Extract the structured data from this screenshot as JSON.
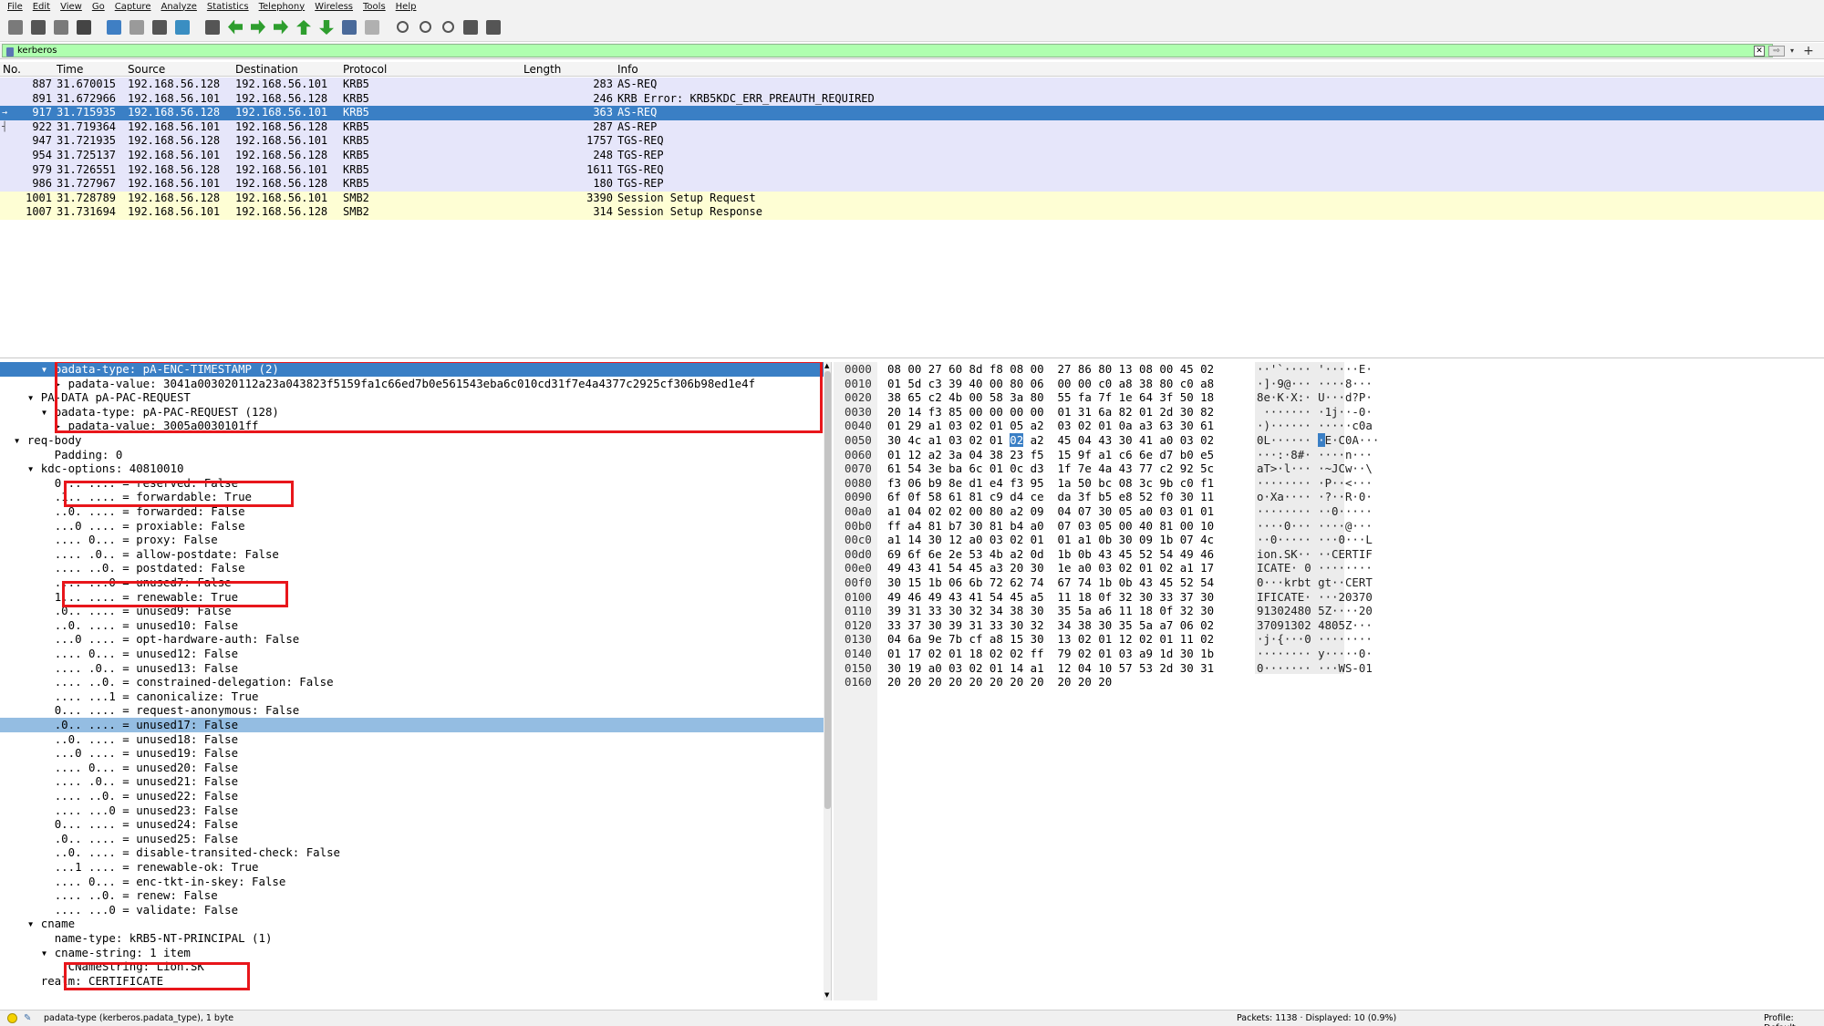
{
  "menu": [
    "File",
    "Edit",
    "View",
    "Go",
    "Capture",
    "Analyze",
    "Statistics",
    "Telephony",
    "Wireless",
    "Tools",
    "Help"
  ],
  "toolbar": {
    "icons": [
      "shark-fin-start-icon",
      "stop-icon",
      "restart-icon",
      "capture-options-icon",
      "open-file-icon",
      "save-file-icon",
      "close-file-icon",
      "reload-icon",
      "find-packet-icon",
      "go-back-icon",
      "go-forward-icon",
      "go-to-packet-icon",
      "go-first-icon",
      "go-last-icon",
      "autoscroll-icon",
      "colorize-icon",
      "zoom-in-icon",
      "zoom-out-icon",
      "zoom-normal-icon",
      "resize-columns-icon",
      "layout-icon"
    ]
  },
  "filter": {
    "value": "kerberos"
  },
  "packet_list": {
    "columns": [
      "No.",
      "Time",
      "Source",
      "Destination",
      "Protocol",
      "Length",
      "Info"
    ],
    "rows": [
      {
        "no": "887",
        "time": "31.670015",
        "src": "192.168.56.128",
        "dst": "192.168.56.101",
        "proto": "KRB5",
        "len": "283",
        "info": "AS-REQ",
        "kind": "krb"
      },
      {
        "no": "891",
        "time": "31.672966",
        "src": "192.168.56.101",
        "dst": "192.168.56.128",
        "proto": "KRB5",
        "len": "246",
        "info": "KRB Error: KRB5KDC_ERR_PREAUTH_REQUIRED",
        "kind": "krb"
      },
      {
        "no": "917",
        "time": "31.715935",
        "src": "192.168.56.128",
        "dst": "192.168.56.101",
        "proto": "KRB5",
        "len": "363",
        "info": "AS-REQ",
        "kind": "sel"
      },
      {
        "no": "922",
        "time": "31.719364",
        "src": "192.168.56.101",
        "dst": "192.168.56.128",
        "proto": "KRB5",
        "len": "287",
        "info": "AS-REP",
        "kind": "krb"
      },
      {
        "no": "947",
        "time": "31.721935",
        "src": "192.168.56.128",
        "dst": "192.168.56.101",
        "proto": "KRB5",
        "len": "1757",
        "info": "TGS-REQ",
        "kind": "krb"
      },
      {
        "no": "954",
        "time": "31.725137",
        "src": "192.168.56.101",
        "dst": "192.168.56.128",
        "proto": "KRB5",
        "len": "248",
        "info": "TGS-REP",
        "kind": "krb"
      },
      {
        "no": "979",
        "time": "31.726551",
        "src": "192.168.56.128",
        "dst": "192.168.56.101",
        "proto": "KRB5",
        "len": "1611",
        "info": "TGS-REQ",
        "kind": "krb"
      },
      {
        "no": "986",
        "time": "31.727967",
        "src": "192.168.56.101",
        "dst": "192.168.56.128",
        "proto": "KRB5",
        "len": "180",
        "info": "TGS-REP",
        "kind": "krb"
      },
      {
        "no": "1001",
        "time": "31.728789",
        "src": "192.168.56.128",
        "dst": "192.168.56.101",
        "proto": "SMB2",
        "len": "3390",
        "info": "Session Setup Request",
        "kind": "smb"
      },
      {
        "no": "1007",
        "time": "31.731694",
        "src": "192.168.56.101",
        "dst": "192.168.56.128",
        "proto": "SMB2",
        "len": "314",
        "info": "Session Setup Response",
        "kind": "smb"
      }
    ]
  },
  "details": {
    "rows": [
      {
        "indent": "      ",
        "arrow": "▾ ",
        "text": "padata-type: pA-ENC-TIMESTAMP (2)",
        "state": "sel"
      },
      {
        "indent": "        ",
        "arrow": "▸ ",
        "text": "padata-value: 3041a003020112a23a043823f5159fa1c66ed7b0e561543eba6c010cd31f7e4a4377c2925cf306b98ed1e4f",
        "state": ""
      },
      {
        "indent": "    ",
        "arrow": "▾ ",
        "text": "PA-DATA pA-PAC-REQUEST",
        "state": ""
      },
      {
        "indent": "      ",
        "arrow": "▾ ",
        "text": "padata-type: pA-PAC-REQUEST (128)",
        "state": ""
      },
      {
        "indent": "        ",
        "arrow": "▸ ",
        "text": "padata-value: 3005a0030101ff",
        "state": ""
      },
      {
        "indent": "  ",
        "arrow": "▾ ",
        "text": "req-body",
        "state": ""
      },
      {
        "indent": "      ",
        "arrow": "",
        "text": "  Padding: 0",
        "state": ""
      },
      {
        "indent": "    ",
        "arrow": "▾ ",
        "text": "kdc-options: 40810010",
        "state": ""
      },
      {
        "indent": "        ",
        "arrow": "",
        "text": "0... .... = reserved: False",
        "state": ""
      },
      {
        "indent": "        ",
        "arrow": "",
        "text": ".1.. .... = forwardable: True",
        "state": ""
      },
      {
        "indent": "        ",
        "arrow": "",
        "text": "..0. .... = forwarded: False",
        "state": ""
      },
      {
        "indent": "        ",
        "arrow": "",
        "text": "...0 .... = proxiable: False",
        "state": ""
      },
      {
        "indent": "        ",
        "arrow": "",
        "text": ".... 0... = proxy: False",
        "state": ""
      },
      {
        "indent": "        ",
        "arrow": "",
        "text": ".... .0.. = allow-postdate: False",
        "state": ""
      },
      {
        "indent": "        ",
        "arrow": "",
        "text": ".... ..0. = postdated: False",
        "state": ""
      },
      {
        "indent": "        ",
        "arrow": "",
        "text": ".... ...0 = unused7: False",
        "state": ""
      },
      {
        "indent": "        ",
        "arrow": "",
        "text": "1... .... = renewable: True",
        "state": ""
      },
      {
        "indent": "        ",
        "arrow": "",
        "text": ".0.. .... = unused9: False",
        "state": ""
      },
      {
        "indent": "        ",
        "arrow": "",
        "text": "..0. .... = unused10: False",
        "state": ""
      },
      {
        "indent": "        ",
        "arrow": "",
        "text": "...0 .... = opt-hardware-auth: False",
        "state": ""
      },
      {
        "indent": "        ",
        "arrow": "",
        "text": ".... 0... = unused12: False",
        "state": ""
      },
      {
        "indent": "        ",
        "arrow": "",
        "text": ".... .0.. = unused13: False",
        "state": ""
      },
      {
        "indent": "        ",
        "arrow": "",
        "text": ".... ..0. = constrained-delegation: False",
        "state": ""
      },
      {
        "indent": "        ",
        "arrow": "",
        "text": ".... ...1 = canonicalize: True",
        "state": ""
      },
      {
        "indent": "        ",
        "arrow": "",
        "text": "0... .... = request-anonymous: False",
        "state": ""
      },
      {
        "indent": "        ",
        "arrow": "",
        "text": ".0.. .... = unused17: False",
        "state": "hl"
      },
      {
        "indent": "        ",
        "arrow": "",
        "text": "..0. .... = unused18: False",
        "state": ""
      },
      {
        "indent": "        ",
        "arrow": "",
        "text": "...0 .... = unused19: False",
        "state": ""
      },
      {
        "indent": "        ",
        "arrow": "",
        "text": ".... 0... = unused20: False",
        "state": ""
      },
      {
        "indent": "        ",
        "arrow": "",
        "text": ".... .0.. = unused21: False",
        "state": ""
      },
      {
        "indent": "        ",
        "arrow": "",
        "text": ".... ..0. = unused22: False",
        "state": ""
      },
      {
        "indent": "        ",
        "arrow": "",
        "text": ".... ...0 = unused23: False",
        "state": ""
      },
      {
        "indent": "        ",
        "arrow": "",
        "text": "0... .... = unused24: False",
        "state": ""
      },
      {
        "indent": "        ",
        "arrow": "",
        "text": ".0.. .... = unused25: False",
        "state": ""
      },
      {
        "indent": "        ",
        "arrow": "",
        "text": "..0. .... = disable-transited-check: False",
        "state": ""
      },
      {
        "indent": "        ",
        "arrow": "",
        "text": "...1 .... = renewable-ok: True",
        "state": ""
      },
      {
        "indent": "        ",
        "arrow": "",
        "text": ".... 0... = enc-tkt-in-skey: False",
        "state": ""
      },
      {
        "indent": "        ",
        "arrow": "",
        "text": ".... ..0. = renew: False",
        "state": ""
      },
      {
        "indent": "        ",
        "arrow": "",
        "text": ".... ...0 = validate: False",
        "state": ""
      },
      {
        "indent": "    ",
        "arrow": "▾ ",
        "text": "cname",
        "state": ""
      },
      {
        "indent": "        ",
        "arrow": "",
        "text": "name-type: kRB5-NT-PRINCIPAL (1)",
        "state": ""
      },
      {
        "indent": "      ",
        "arrow": "▾ ",
        "text": "cname-string: 1 item",
        "state": ""
      },
      {
        "indent": "          ",
        "arrow": "",
        "text": "CNameString: Lion.SK",
        "state": ""
      },
      {
        "indent": "      ",
        "arrow": "",
        "text": "realm: CERTIFICATE",
        "state": ""
      }
    ]
  },
  "hex": {
    "rows": [
      {
        "off": "0000",
        "b1": "08 00 27 60 8d f8 08 00",
        "b2": "27 86 80 13 08 00 45 02",
        "ascii": "··'`···· '·····E·"
      },
      {
        "off": "0010",
        "b1": "01 5d c3 39 40 00 80 06",
        "b2": "00 00 c0 a8 38 80 c0 a8",
        "ascii": "·]·9@··· ····8···"
      },
      {
        "off": "0020",
        "b1": "38 65 c2 4b 00 58 3a 80",
        "b2": "55 fa 7f 1e 64 3f 50 18",
        "ascii": "8e·K·X:· U···d?P·"
      },
      {
        "off": "0030",
        "b1": "20 14 f3 85 00 00 00 00",
        "b2": "01 31 6a 82 01 2d 30 82",
        "ascii": " ······· ·1j··-0·"
      },
      {
        "off": "0040",
        "b1": "01 29 a1 03 02 01 05 a2",
        "b2": "03 02 01 0a a3 63 30 61",
        "ascii": "·)······ ·····c0a"
      },
      {
        "off": "0050",
        "b1pre": "30 4c a1 03 02 01 ",
        "bsel": "02",
        "b1post": " a2",
        "b2": "45 04 43 30 41 a0 03 02",
        "asciipre": "0L······ ",
        "asciisel": "·",
        "asciipost": "E·C0A···"
      },
      {
        "off": "0060",
        "b1": "01 12 a2 3a 04 38 23 f5",
        "b2": "15 9f a1 c6 6e d7 b0 e5",
        "ascii": "···:·8#· ····n···"
      },
      {
        "off": "0070",
        "b1": "61 54 3e ba 6c 01 0c d3",
        "b2": "1f 7e 4a 43 77 c2 92 5c",
        "ascii": "aT>·l··· ·~JCw··\\"
      },
      {
        "off": "0080",
        "b1": "f3 06 b9 8e d1 e4 f3 95",
        "b2": "1a 50 bc 08 3c 9b c0 f1",
        "ascii": "········ ·P··<···"
      },
      {
        "off": "0090",
        "b1": "6f 0f 58 61 81 c9 d4 ce",
        "b2": "da 3f b5 e8 52 f0 30 11",
        "ascii": "o·Xa···· ·?··R·0·"
      },
      {
        "off": "00a0",
        "b1": "a1 04 02 02 00 80 a2 09",
        "b2": "04 07 30 05 a0 03 01 01",
        "ascii": "········ ··0·····"
      },
      {
        "off": "00b0",
        "b1": "ff a4 81 b7 30 81 b4 a0",
        "b2": "07 03 05 00 40 81 00 10",
        "ascii": "····0··· ····@···"
      },
      {
        "off": "00c0",
        "b1": "a1 14 30 12 a0 03 02 01",
        "b2": "01 a1 0b 30 09 1b 07 4c",
        "ascii": "··0····· ···0···L"
      },
      {
        "off": "00d0",
        "b1": "69 6f 6e 2e 53 4b a2 0d",
        "b2": "1b 0b 43 45 52 54 49 46",
        "ascii": "ion.SK·· ··CERTIF"
      },
      {
        "off": "00e0",
        "b1": "49 43 41 54 45 a3 20 30",
        "b2": "1e a0 03 02 01 02 a1 17",
        "ascii": "ICATE· 0 ········"
      },
      {
        "off": "00f0",
        "b1": "30 15 1b 06 6b 72 62 74",
        "b2": "67 74 1b 0b 43 45 52 54",
        "ascii": "0···krbt gt··CERT"
      },
      {
        "off": "0100",
        "b1": "49 46 49 43 41 54 45 a5",
        "b2": "11 18 0f 32 30 33 37 30",
        "ascii": "IFICATE· ···20370"
      },
      {
        "off": "0110",
        "b1": "39 31 33 30 32 34 38 30",
        "b2": "35 5a a6 11 18 0f 32 30",
        "ascii": "91302480 5Z····20"
      },
      {
        "off": "0120",
        "b1": "33 37 30 39 31 33 30 32",
        "b2": "34 38 30 35 5a a7 06 02",
        "ascii": "37091302 4805Z···"
      },
      {
        "off": "0130",
        "b1": "04 6a 9e 7b cf a8 15 30",
        "b2": "13 02 01 12 02 01 11 02",
        "ascii": "·j·{···0 ········"
      },
      {
        "off": "0140",
        "b1": "01 17 02 01 18 02 02 ff",
        "b2": "79 02 01 03 a9 1d 30 1b",
        "ascii": "········ y·····0·"
      },
      {
        "off": "0150",
        "b1": "30 19 a0 03 02 01 14 a1",
        "b2": "12 04 10 57 53 2d 30 31",
        "ascii": "0······· ···WS-01"
      },
      {
        "off": "0160",
        "b1": "20 20 20 20 20 20 20 20",
        "b2": "20 20 20",
        "ascii": ""
      }
    ]
  },
  "status": {
    "field": "padata-type (kerberos.padata_type), 1 byte",
    "packets": "Packets: 1138 · Displayed: 10 (0.9%)",
    "profile": "Profile: Default"
  },
  "colors": {
    "selection": "#3a7fc5",
    "krb_row": "#e6e6fa",
    "smb_row": "#fefed4",
    "filter_ok": "#afffaf",
    "annotation": "#e8161b"
  }
}
